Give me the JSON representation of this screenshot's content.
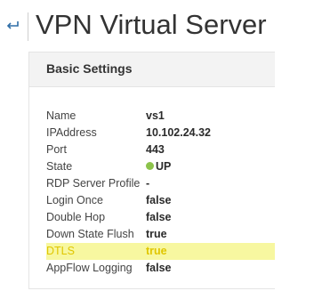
{
  "header": {
    "title": "VPN Virtual Server",
    "back_icon": "back-arrow-icon"
  },
  "panel": {
    "title": "Basic Settings",
    "rows": [
      {
        "label": "Name",
        "value": "vs1"
      },
      {
        "label": "IPAddress",
        "value": "10.102.24.32"
      },
      {
        "label": "Port",
        "value": "443"
      },
      {
        "label": "State",
        "value": "UP",
        "status_color": "#8cc34b"
      },
      {
        "label": "RDP Server Profile",
        "value": "-"
      },
      {
        "label": "Login Once",
        "value": "false"
      },
      {
        "label": "Double Hop",
        "value": "false"
      },
      {
        "label": "Down State Flush",
        "value": "true"
      },
      {
        "label": "DTLS",
        "value": "true",
        "highlighted": true
      },
      {
        "label": "AppFlow Logging",
        "value": "false"
      }
    ]
  },
  "colors": {
    "highlight": "#f7f7a0",
    "state_up": "#8cc34b",
    "back_icon": "#2f6ea7"
  }
}
